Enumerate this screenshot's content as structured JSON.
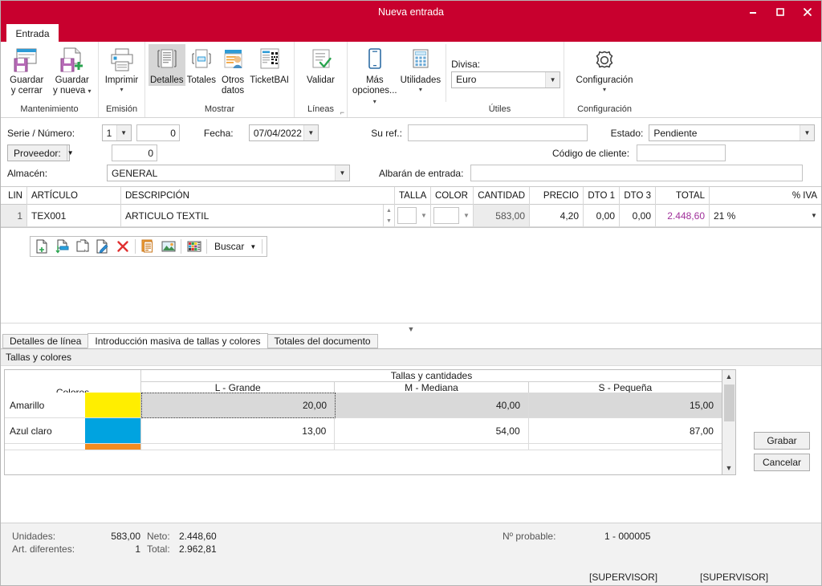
{
  "window": {
    "title": "Nueva entrada",
    "minimize_icon": "minimize-icon",
    "maximize_icon": "maximize-icon",
    "close_icon": "close-icon",
    "accent_color": "#c8002e"
  },
  "ribbon": {
    "tab": "Entrada",
    "groups": [
      {
        "label": "Mantenimiento",
        "buttons": [
          {
            "label": "Guardar\ny cerrar",
            "icon": "save-close-icon",
            "caret": false
          },
          {
            "label": "Guardar\ny nueva",
            "icon": "save-new-icon",
            "caret": true
          }
        ]
      },
      {
        "label": "Emisión",
        "buttons": [
          {
            "label": "Imprimir",
            "icon": "printer-icon",
            "caret": true
          }
        ]
      },
      {
        "label": "Mostrar",
        "buttons": [
          {
            "label": "Detalles",
            "icon": "details-icon",
            "caret": false,
            "selected": true
          },
          {
            "label": "Totales",
            "icon": "totals-icon",
            "caret": false
          },
          {
            "label": "Otros\ndatos",
            "icon": "other-data-icon",
            "caret": false
          },
          {
            "label": "TicketBAI",
            "icon": "ticketbai-icon",
            "caret": false
          }
        ]
      },
      {
        "label": "Líneas",
        "dialog_launcher": "dialog-launcher-icon",
        "buttons": [
          {
            "label": "Validar",
            "icon": "validate-icon",
            "caret": false
          }
        ]
      },
      {
        "label": "Útiles",
        "buttons": [
          {
            "label": "Más\nopciones...",
            "icon": "more-options-icon",
            "caret": true
          },
          {
            "label": "Utilidades",
            "icon": "utilities-icon",
            "caret": true
          }
        ],
        "divisa_label": "Divisa:",
        "divisa_value": "Euro"
      },
      {
        "label": "Configuración",
        "buttons": [
          {
            "label": "Configuración",
            "icon": "gear-icon",
            "caret": true
          }
        ]
      }
    ]
  },
  "header_form": {
    "serie_numero_label": "Serie / Número:",
    "serie_value": "1",
    "numero_value": "0",
    "fecha_label": "Fecha:",
    "fecha_value": "07/04/2022",
    "su_ref_label": "Su ref.:",
    "su_ref_value": "",
    "estado_label": "Estado:",
    "estado_value": "Pendiente",
    "proveedor_label": "Proveedor:",
    "proveedor_value": "0",
    "codigo_cliente_label": "Código de cliente:",
    "codigo_cliente_value": "",
    "almacen_label": "Almacén:",
    "almacen_value": "GENERAL",
    "albaran_label": "Albarán de entrada:",
    "albaran_value": ""
  },
  "lines_grid": {
    "columns": [
      "LIN",
      "ARTÍCULO",
      "DESCRIPCIÓN",
      "TALLA",
      "COLOR",
      "CANTIDAD",
      "PRECIO",
      "DTO 1",
      "DTO 3",
      "TOTAL",
      "% IVA"
    ],
    "rows": [
      {
        "lin": "1",
        "articulo": "TEX001",
        "descripcion": "ARTICULO TEXTIL",
        "talla": "",
        "color": "",
        "cantidad": "583,00",
        "precio": "4,20",
        "dto1": "0,00",
        "dto3": "0,00",
        "total": "2.448,60",
        "iva": "21 %"
      }
    ],
    "total_color": "#a0309a"
  },
  "mini_toolbar": {
    "buttons": [
      {
        "icon": "new-line-icon"
      },
      {
        "icon": "insert-line-icon"
      },
      {
        "icon": "copy-line-icon"
      },
      {
        "icon": "edit-line-icon"
      },
      {
        "icon": "delete-line-icon"
      },
      {
        "icon": "notes-icon"
      },
      {
        "icon": "image-icon"
      },
      {
        "icon": "colors-sizes-icon"
      }
    ],
    "search_label": "Buscar"
  },
  "bottom_tabs": [
    {
      "label": "Detalles de línea",
      "active": false
    },
    {
      "label": "Introducción masiva de tallas y colores",
      "active": true
    },
    {
      "label": "Totales del documento",
      "active": false
    }
  ],
  "section_bar": {
    "label": "Tallas y colores"
  },
  "sizes_colors_table": {
    "colors_header": "Colores",
    "span_header": "Tallas y cantidades",
    "size_headers": [
      "L - Grande",
      "M - Mediana",
      "S - Pequeña"
    ],
    "rows": [
      {
        "name": "Amarillo",
        "swatch": "#ffee00",
        "values": [
          "20,00",
          "40,00",
          "15,00"
        ],
        "selected": true
      },
      {
        "name": "Azul claro",
        "swatch": "#00a3e0",
        "values": [
          "13,00",
          "54,00",
          "87,00"
        ],
        "selected": false
      },
      {
        "name": "",
        "swatch": "#f28b20",
        "values": [
          "",
          "",
          ""
        ],
        "selected": false
      }
    ],
    "scroll_up_icon": "chevron-up-icon",
    "scroll_down_icon": "chevron-down-icon"
  },
  "side_buttons": {
    "grabar": "Grabar",
    "cancelar": "Cancelar"
  },
  "status_bar": {
    "unidades_label": "Unidades:",
    "unidades_value": "583,00",
    "neto_label": "Neto:",
    "neto_value": "2.448,60",
    "art_diferentes_label": "Art. diferentes:",
    "art_diferentes_value": "1",
    "total_label": "Total:",
    "total_value": "2.962,81",
    "n_probable_label": "Nº probable:",
    "n_probable_value": "1 - 000005",
    "user_left": "[SUPERVISOR]",
    "user_right": "[SUPERVISOR]"
  },
  "collapser_icon": "chevron-down-icon"
}
